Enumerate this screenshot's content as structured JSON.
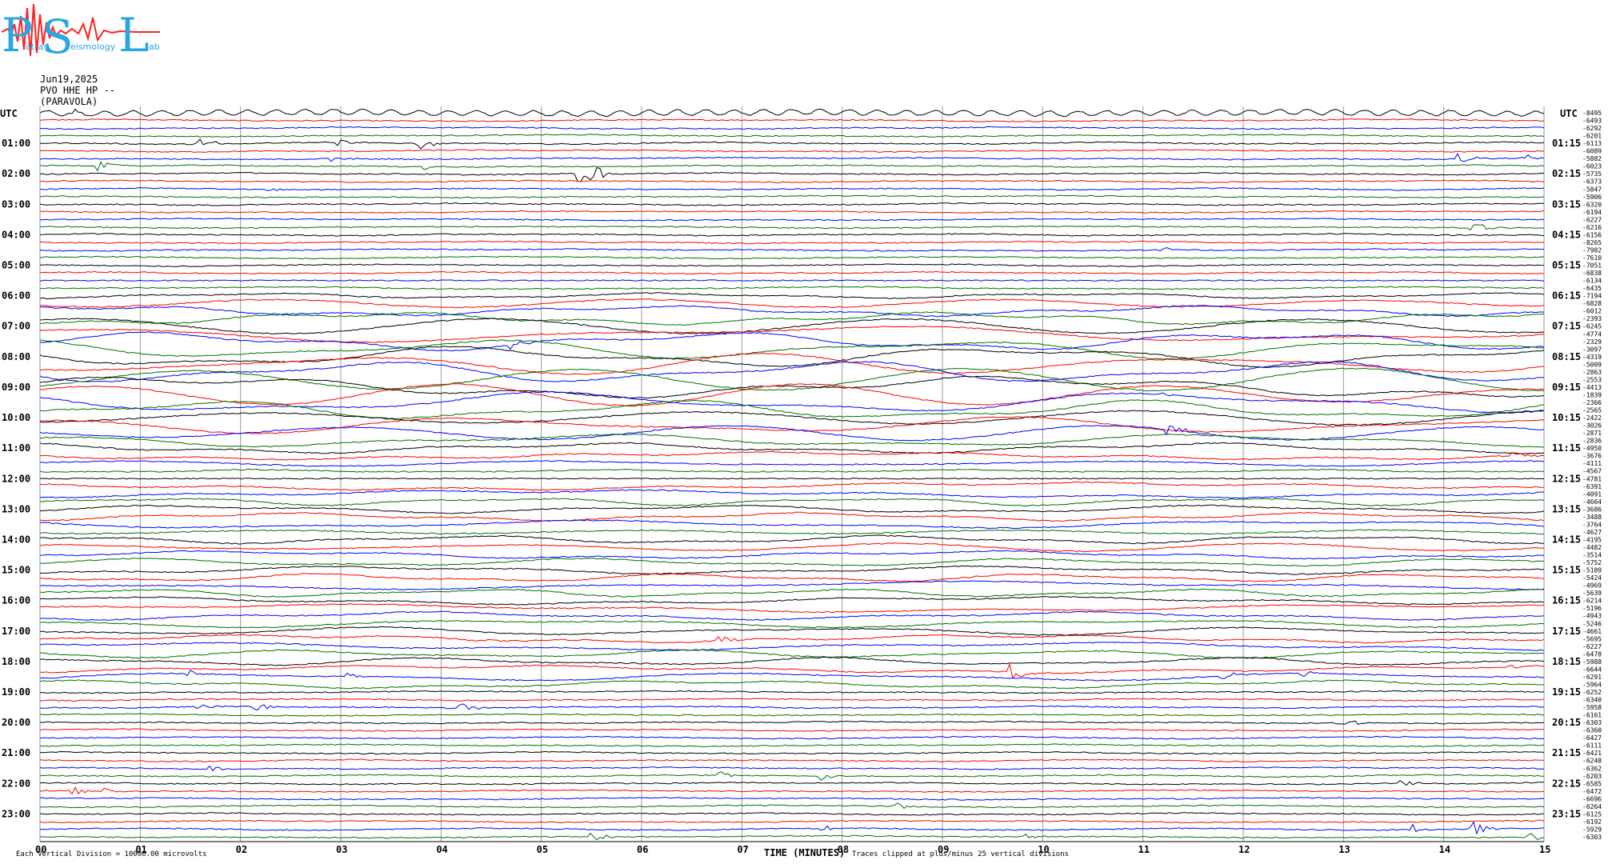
{
  "header": {
    "date": "Jun19,2025",
    "station": "PVO HHE HP --",
    "location": "(PARAVOLA)"
  },
  "logo": {
    "text": "PSL",
    "small_words": [
      "atras",
      "eismology",
      "ab"
    ]
  },
  "footer": {
    "left_note": "Each Vertical Division = 10000.00 microvolts",
    "x_label": "TIME (MINUTES)",
    "clip_note": "Traces clipped at plus/minus 25 vertical divisions"
  },
  "colors": {
    "trace_cycle": [
      "#000000",
      "#ff0000",
      "#0000ff",
      "#007000"
    ],
    "grid": "#9a9a9a",
    "logo_blue": "#2aa6e0",
    "logo_red": "#ff2020"
  },
  "chart_data": {
    "type": "line",
    "x_unit": "minutes",
    "xlim": [
      0,
      15
    ],
    "x_ticks": [
      "00",
      "01",
      "02",
      "03",
      "04",
      "05",
      "06",
      "07",
      "08",
      "09",
      "10",
      "11",
      "12",
      "13",
      "14",
      "15"
    ],
    "left_axis_title": "UTC",
    "right_axis_title": "UTC",
    "left_labels": [
      "01:00",
      "02:00",
      "03:00",
      "04:00",
      "05:00",
      "06:00",
      "07:00",
      "08:00",
      "09:00",
      "10:00",
      "11:00",
      "12:00",
      "13:00",
      "14:00",
      "15:00",
      "16:00",
      "17:00",
      "18:00",
      "19:00",
      "20:00",
      "21:00",
      "22:00",
      "23:00"
    ],
    "right_labels": [
      "01:15",
      "02:15",
      "03:15",
      "04:15",
      "05:15",
      "06:15",
      "07:15",
      "08:15",
      "09:15",
      "10:15",
      "11:15",
      "12:15",
      "13:15",
      "14:15",
      "15:15",
      "16:15",
      "17:15",
      "18:15",
      "19:15",
      "20:15",
      "21:15",
      "22:15",
      "23:15"
    ],
    "trace_count": 96,
    "trace_interval_minutes": 15,
    "trace_offsets": [
      "-8495",
      "-6493",
      "-6292",
      "-6201",
      "-6113",
      "-6089",
      "-5882",
      "-6023",
      "-5735",
      "-6373",
      "-5847",
      "-5906",
      "-6320",
      "-6194",
      "-6227",
      "-6216",
      "-6156",
      "-8265",
      "-7982",
      "-7610",
      "-7051",
      "-6838",
      "-6134",
      "-6435",
      "-7194",
      "-6828",
      "-6012",
      "-2393",
      "-6245",
      "-4774",
      "-2329",
      "-3097",
      "-4319",
      "-5009",
      "-2863",
      "-2553",
      "-4413",
      "-1839",
      "-2366",
      "-2565",
      "-2422",
      "-3026",
      "-2871",
      "-2836",
      "-4950",
      "-3676",
      "-4111",
      "-4567",
      "-4781",
      "-6391",
      "-4091",
      "-4664",
      "-3686",
      "-3488",
      "-3764",
      "-4627",
      "-4195",
      "-4482",
      "-3514",
      "-5752",
      "-5189",
      "-5424",
      "-4969",
      "-5639",
      "-6214",
      "-5196",
      "-4943",
      "-5246",
      "-4661",
      "-5695",
      "-6227",
      "-6478",
      "-5988",
      "-6644",
      "-6291",
      "-5964",
      "-6252",
      "-6340",
      "-5958",
      "-6161",
      "-6303",
      "-6360",
      "-6427",
      "-6111",
      "-6421",
      "-6248",
      "-6362",
      "-6203",
      "-6585",
      "-6472",
      "-6696",
      "-6264",
      "-6125",
      "-6192",
      "-5929",
      "-6303"
    ],
    "events": [
      {
        "trace": 0,
        "minute": 0.3,
        "amp": 4
      },
      {
        "trace": 4,
        "minute": 1.6,
        "amp": 7
      },
      {
        "trace": 4,
        "minute": 1.75,
        "amp": 6
      },
      {
        "trace": 4,
        "minute": 3.0,
        "amp": 5
      },
      {
        "trace": 4,
        "minute": 3.8,
        "amp": 8
      },
      {
        "trace": 6,
        "minute": 2.9,
        "amp": 4
      },
      {
        "trace": 6,
        "minute": 14.15,
        "amp": 8
      },
      {
        "trace": 6,
        "minute": 14.8,
        "amp": 6
      },
      {
        "trace": 7,
        "minute": 0.6,
        "amp": 7
      },
      {
        "trace": 7,
        "minute": 3.85,
        "amp": 4
      },
      {
        "trace": 8,
        "minute": 5.4,
        "amp": 10
      },
      {
        "trace": 8,
        "minute": 5.5,
        "amp": 12
      },
      {
        "trace": 10,
        "minute": 2.3,
        "amp": 4
      },
      {
        "trace": 15,
        "minute": 14.3,
        "amp": 12
      },
      {
        "trace": 18,
        "minute": 11.2,
        "amp": 4
      },
      {
        "trace": 30,
        "minute": 4.7,
        "amp": 8
      },
      {
        "trace": 38,
        "minute": 11.2,
        "amp": 5
      },
      {
        "trace": 42,
        "minute": 11.25,
        "amp": 15
      },
      {
        "trace": 45,
        "minute": 14.7,
        "amp": 5
      },
      {
        "trace": 69,
        "minute": 4.3,
        "amp": 6
      },
      {
        "trace": 69,
        "minute": 6.8,
        "amp": 5
      },
      {
        "trace": 73,
        "minute": 9.7,
        "amp": 14
      },
      {
        "trace": 73,
        "minute": 14.6,
        "amp": 6
      },
      {
        "trace": 74,
        "minute": 1.5,
        "amp": 5
      },
      {
        "trace": 74,
        "minute": 3.1,
        "amp": 5
      },
      {
        "trace": 74,
        "minute": 11.8,
        "amp": 7
      },
      {
        "trace": 74,
        "minute": 12.6,
        "amp": 5
      },
      {
        "trace": 78,
        "minute": 1.6,
        "amp": 6
      },
      {
        "trace": 78,
        "minute": 2.15,
        "amp": 6
      },
      {
        "trace": 78,
        "minute": 4.2,
        "amp": 7
      },
      {
        "trace": 80,
        "minute": 12.95,
        "amp": 18
      },
      {
        "trace": 86,
        "minute": 1.7,
        "amp": 5
      },
      {
        "trace": 87,
        "minute": 6.8,
        "amp": 4
      },
      {
        "trace": 87,
        "minute": 7.8,
        "amp": 5
      },
      {
        "trace": 88,
        "minute": 13.6,
        "amp": 5
      },
      {
        "trace": 89,
        "minute": 0.3,
        "amp": 8
      },
      {
        "trace": 89,
        "minute": 0.65,
        "amp": 4
      },
      {
        "trace": 91,
        "minute": 8.55,
        "amp": 5
      },
      {
        "trace": 94,
        "minute": 7.8,
        "amp": 5
      },
      {
        "trace": 94,
        "minute": 13.7,
        "amp": 7
      },
      {
        "trace": 94,
        "minute": 14.3,
        "amp": 9
      },
      {
        "trace": 95,
        "minute": 5.5,
        "amp": 9
      },
      {
        "trace": 95,
        "minute": 9.85,
        "amp": 5
      },
      {
        "trace": 95,
        "minute": 14.85,
        "amp": 6
      }
    ]
  }
}
